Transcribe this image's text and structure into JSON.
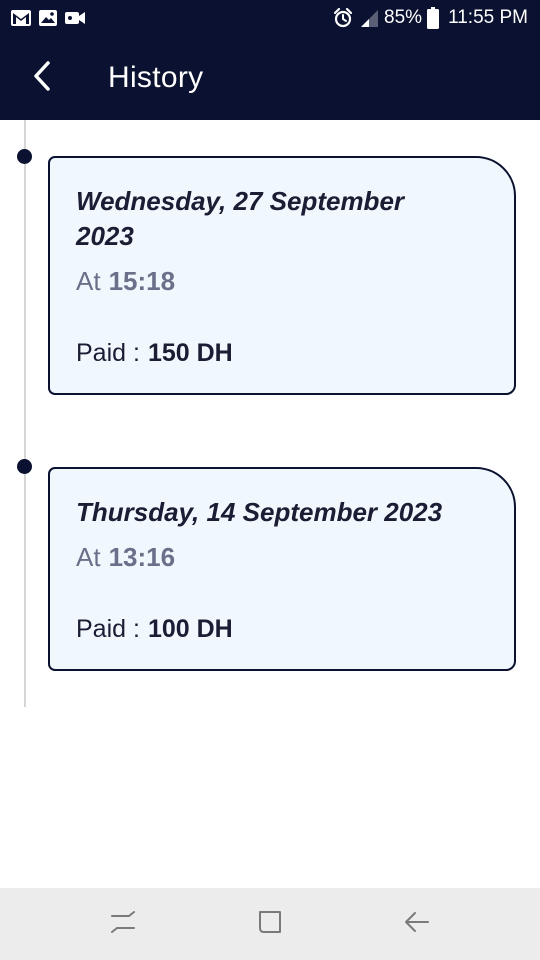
{
  "status_bar": {
    "battery": "85%",
    "time": "11:55 PM",
    "icons_left": [
      "gmail-icon",
      "gallery-icon",
      "video-icon"
    ],
    "icons_right": [
      "alarm-icon",
      "signal-icon",
      "battery-icon"
    ]
  },
  "header": {
    "back_icon": "back-arrow-icon",
    "title": "History"
  },
  "history": {
    "items": [
      {
        "date": "Wednesday, 27 September 2023",
        "time_label": "At",
        "time": "15:18",
        "paid_label": "Paid :",
        "paid_value": "150 DH"
      },
      {
        "date": "Thursday, 14 September 2023",
        "time_label": "At",
        "time": "13:16",
        "paid_label": "Paid :",
        "paid_value": "100 DH"
      }
    ]
  },
  "nav_bar": {
    "buttons": [
      "recents-icon",
      "home-icon",
      "back-icon"
    ]
  },
  "colors": {
    "header_bg": "#0b1130",
    "card_bg": "#f0f8fe",
    "card_border": "#0b1130",
    "muted_text": "#6a7089"
  }
}
